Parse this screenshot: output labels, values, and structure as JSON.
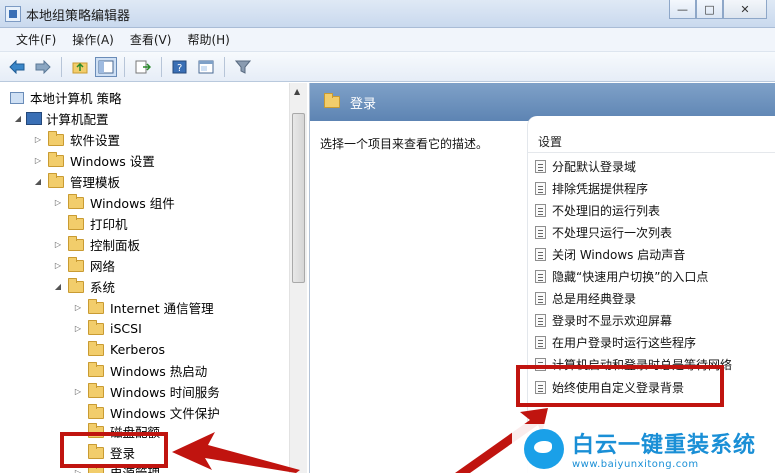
{
  "window": {
    "title": "本地组策略编辑器",
    "minimize_glyph": "▭",
    "restore_glyph": "□",
    "close_glyph": "✕"
  },
  "menu": [
    "文件(F)",
    "操作(A)",
    "查看(V)",
    "帮助(H)"
  ],
  "toolbar": {
    "icons": [
      "back-arrow-icon",
      "forward-arrow-icon",
      "up-folder-icon",
      "show-hide-tree-icon",
      "export-list-icon",
      "help-icon",
      "properties-icon",
      "filter-icon"
    ]
  },
  "tree": {
    "root": "本地计算机 策略",
    "computer_config": "计算机配置",
    "software_settings": "软件设置",
    "windows_settings": "Windows 设置",
    "admin_templates": "管理模板",
    "windows_components": "Windows 组件",
    "printers": "打印机",
    "control_panel": "控制面板",
    "network": "网络",
    "system": "系统",
    "internet_comm": "Internet 通信管理",
    "iscsi": "iSCSI",
    "kerberos": "Kerberos",
    "windows_hotstart": "Windows 热启动",
    "windows_time": "Windows 时间服务",
    "windows_file_protect": "Windows 文件保护",
    "disk_quota": "磁盘配额",
    "logon": "登录",
    "power_mgmt": "电源管理"
  },
  "right": {
    "header_title": "登录",
    "description": "选择一个项目来查看它的描述。",
    "settings_header": "设置",
    "settings": [
      "分配默认登录域",
      "排除凭据提供程序",
      "不处理旧的运行列表",
      "不处理只运行一次列表",
      "关闭 Windows 启动声音",
      "隐藏“快速用户切换”的入口点",
      "总是用经典登录",
      "登录时不显示欢迎屏幕",
      "在用户登录时运行这些程序",
      "计算机启动和登录时总是等待网络",
      "始终使用自定义登录背景"
    ]
  },
  "watermark": {
    "cn": "白云一键重装系统",
    "en": "www.baiyunxitong.com"
  }
}
